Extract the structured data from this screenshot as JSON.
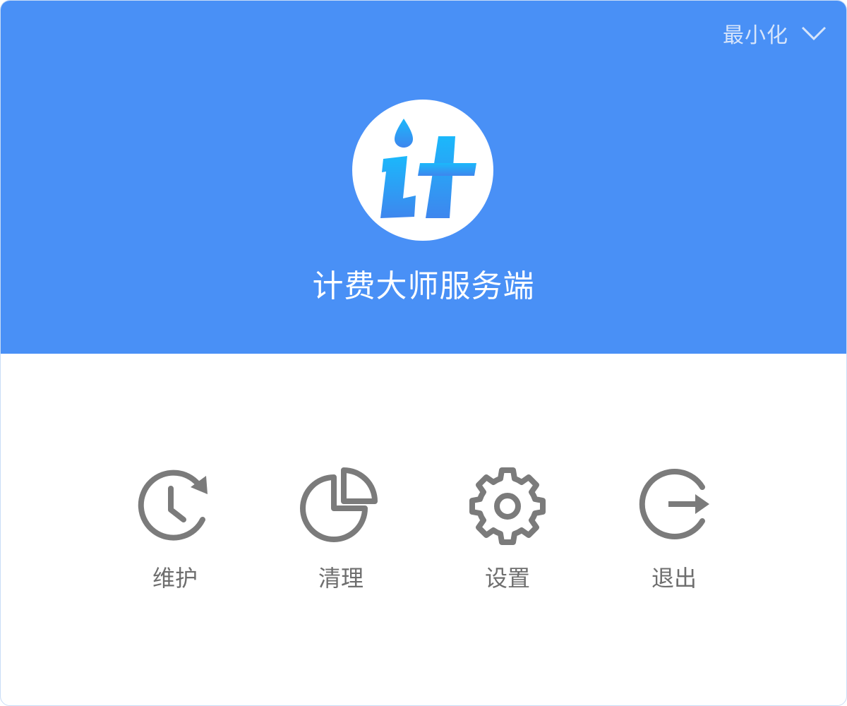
{
  "window": {
    "minimize_label": "最小化",
    "minimize_icon": "chevron-down-icon",
    "header_color": "#4990f6"
  },
  "app": {
    "logo_icon": "it-droplet-logo",
    "title": "计费大师服务端"
  },
  "actions": [
    {
      "label": "维护",
      "icon": "clock-refresh-icon"
    },
    {
      "label": "清理",
      "icon": "pie-chart-icon"
    },
    {
      "label": "设置",
      "icon": "gear-icon"
    },
    {
      "label": "退出",
      "icon": "exit-icon"
    }
  ],
  "colors": {
    "icon_gray": "#7b7b7b",
    "logo_gradient_top": "#1bb8fb",
    "logo_gradient_bottom": "#3e86ee"
  }
}
